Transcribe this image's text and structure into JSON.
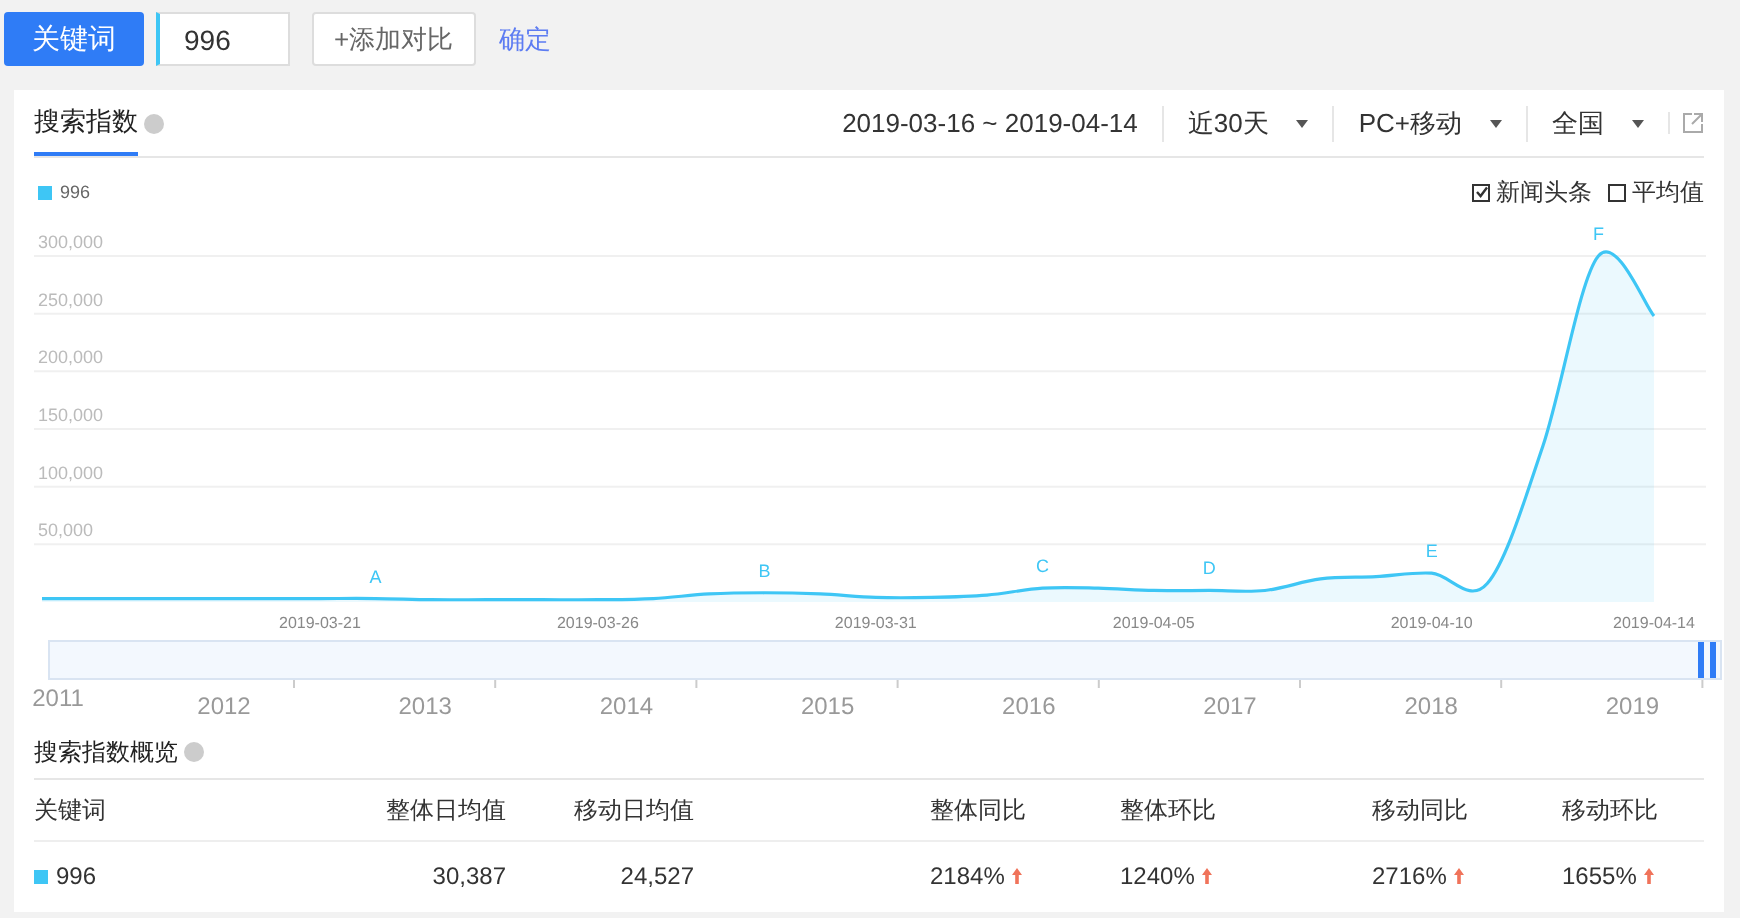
{
  "top_bar": {
    "keyword_button": "关键词",
    "keyword_input": "996",
    "add_compare_button": "+添加对比",
    "confirm_link": "确定"
  },
  "panel": {
    "tab": {
      "label": "搜索指数",
      "selected": true
    },
    "date_range": "2019-03-16 ~ 2019-04-14",
    "filters": [
      {
        "label": "近30天"
      },
      {
        "label": "PC+移动"
      },
      {
        "label": "全国"
      }
    ],
    "toggles": [
      {
        "label": "新闻头条",
        "checked": true
      },
      {
        "label": "平均值",
        "checked": false
      }
    ],
    "chart_data": {
      "type": "area",
      "categories": [
        null,
        null,
        null,
        null,
        null,
        "2019-03-21",
        null,
        null,
        null,
        null,
        "2019-03-26",
        null,
        null,
        null,
        null,
        "2019-03-31",
        null,
        null,
        null,
        null,
        "2019-04-05",
        null,
        null,
        null,
        null,
        "2019-04-10",
        null,
        null,
        null,
        "2019-04-14"
      ],
      "series": [
        {
          "name": "996",
          "color": "#3ec6f5",
          "values": [
            3000,
            3000,
            3000,
            3000,
            3000,
            3000,
            3000,
            2000,
            2000,
            2000,
            2000,
            3000,
            7000,
            8000,
            7000,
            4000,
            4000,
            6000,
            12000,
            12000,
            10000,
            10000,
            10000,
            20000,
            22000,
            25000,
            16000,
            135000,
            300000,
            248000
          ]
        }
      ],
      "ylim": [
        0,
        300000
      ],
      "grid": true,
      "yticks": [
        {
          "value": 50000,
          "label": "50,000"
        },
        {
          "value": 100000,
          "label": "100,000"
        },
        {
          "value": 150000,
          "label": "150,000"
        },
        {
          "value": 200000,
          "label": "200,000"
        },
        {
          "value": 250000,
          "label": "250,000"
        },
        {
          "value": 300000,
          "label": "300,000"
        }
      ],
      "annotations": [
        {
          "text": "A"
        },
        {
          "text": "B"
        },
        {
          "text": "C"
        },
        {
          "text": "D"
        },
        {
          "text": "E"
        },
        {
          "text": "F"
        }
      ]
    },
    "timeline": {
      "years": [
        "2011",
        "2012",
        "2013",
        "2014",
        "2015",
        "2016",
        "2017",
        "2018",
        "2019"
      ]
    }
  },
  "overview": {
    "title": "搜索指数概览",
    "columns": [
      "关键词",
      "整体日均值",
      "移动日均值",
      "整体同比",
      "整体环比",
      "移动同比",
      "移动环比"
    ],
    "rows": [
      {
        "color": "#3ec6f5",
        "cells": [
          {
            "value": "996"
          },
          {
            "value": "30,387"
          },
          {
            "value": "24,527"
          },
          {
            "value": "2184%",
            "rising": true
          },
          {
            "value": "1240%",
            "rising": true
          },
          {
            "value": "2716%",
            "rising": true
          },
          {
            "value": "1655%",
            "rising": true
          }
        ]
      }
    ]
  }
}
